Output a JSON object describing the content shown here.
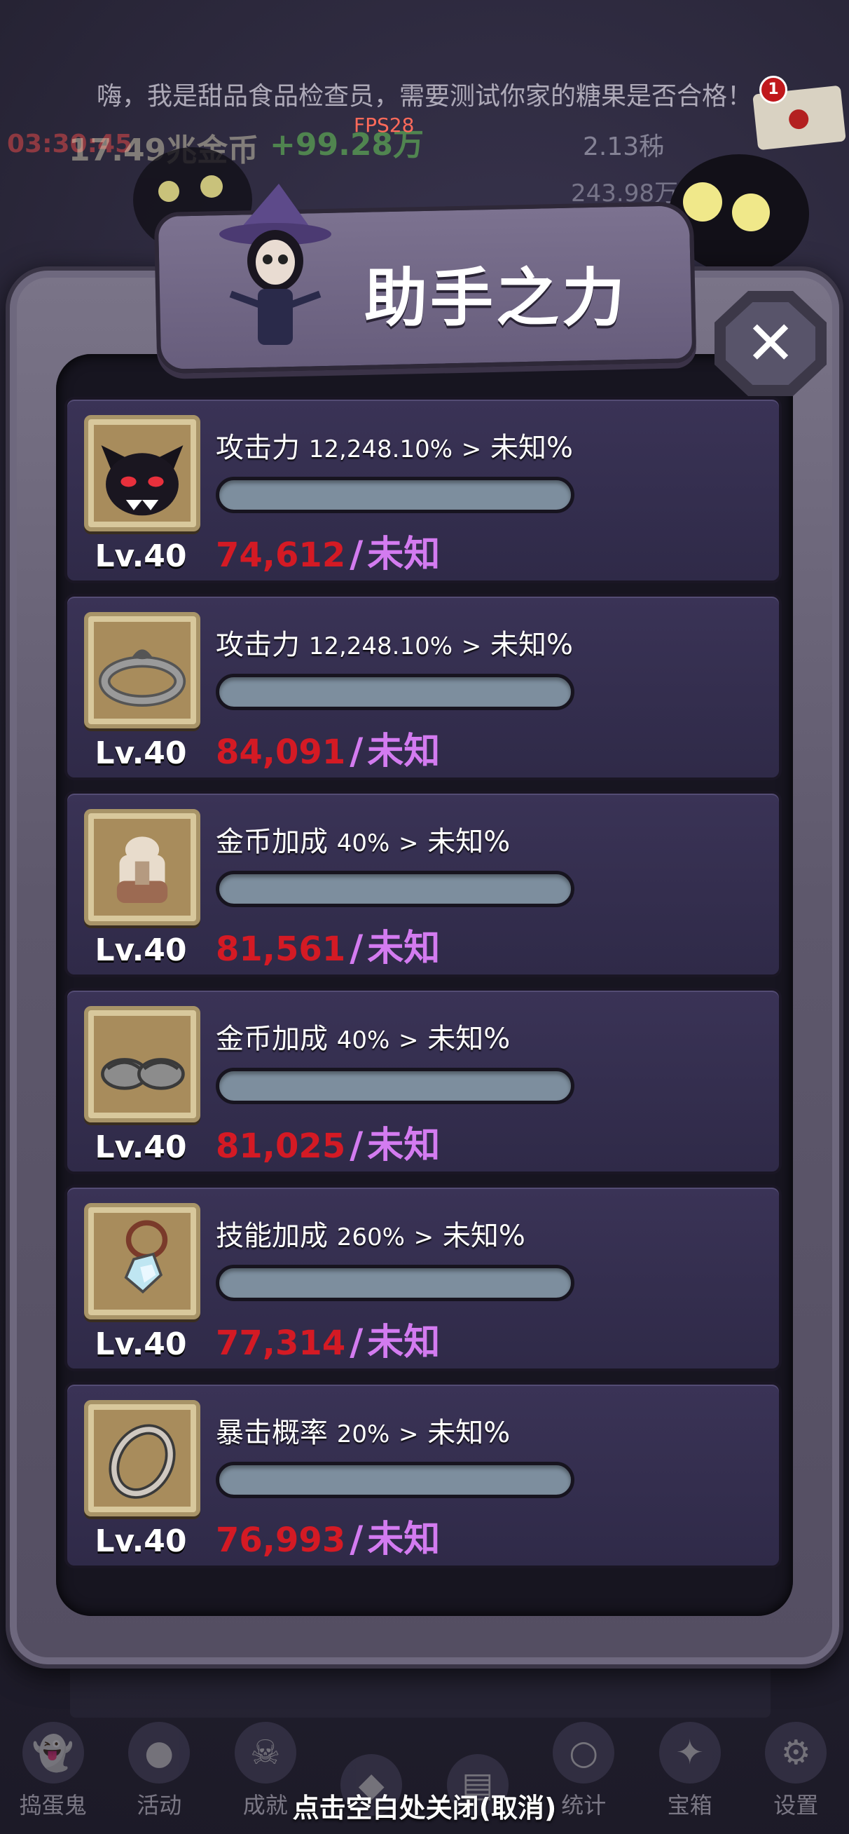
{
  "background": {
    "marquee": "嗨，我是甜品食品检查员，需要测试你家的糖果是否合格！",
    "fps": "FPS28",
    "timer": "03:30:45",
    "gold": "17.49兆金币",
    "gain": "+99.28万",
    "rate": "2.13秭",
    "total": "243.98万",
    "mail_badge": "1",
    "nav": [
      {
        "label": "捣蛋鬼",
        "icon": "ghost-icon"
      },
      {
        "label": "活动",
        "icon": "cauldron-icon"
      },
      {
        "label": "成就",
        "icon": "skull-icon"
      },
      {
        "label": "",
        "icon": "demon-icon"
      },
      {
        "label": "",
        "icon": "book-icon"
      },
      {
        "label": "统计",
        "icon": "orb-icon"
      },
      {
        "label": "宝箱",
        "icon": "gift-icon"
      },
      {
        "label": "设置",
        "icon": "gear-icon"
      }
    ],
    "close_hint": "点击空白处关闭(取消)"
  },
  "dialog": {
    "title": "助手之力",
    "close_icon": "close-icon",
    "items": [
      {
        "icon": "demon-head-icon",
        "level": "Lv.40",
        "stat_name": "攻击力",
        "stat_value": "12,248.10%",
        "arrow": ">",
        "next_value": "未知%",
        "have": "74,612",
        "need": "未知",
        "progress": 0
      },
      {
        "icon": "headband-icon",
        "level": "Lv.40",
        "stat_name": "攻击力",
        "stat_value": "12,248.10%",
        "arrow": ">",
        "next_value": "未知%",
        "have": "84,091",
        "need": "未知",
        "progress": 0
      },
      {
        "icon": "cloak-icon",
        "level": "Lv.40",
        "stat_name": "金币加成",
        "stat_value": "40%",
        "arrow": ">",
        "next_value": "未知%",
        "have": "81,561",
        "need": "未知",
        "progress": 0
      },
      {
        "icon": "slippers-icon",
        "level": "Lv.40",
        "stat_name": "金币加成",
        "stat_value": "40%",
        "arrow": ">",
        "next_value": "未知%",
        "have": "81,025",
        "need": "未知",
        "progress": 0
      },
      {
        "icon": "gem-pendant-icon",
        "level": "Lv.40",
        "stat_name": "技能加成",
        "stat_value": "260%",
        "arrow": ">",
        "next_value": "未知%",
        "have": "77,314",
        "need": "未知",
        "progress": 0
      },
      {
        "icon": "ring-icon",
        "level": "Lv.40",
        "stat_name": "暴击概率",
        "stat_value": "20%",
        "arrow": ">",
        "next_value": "未知%",
        "have": "76,993",
        "need": "未知",
        "progress": 0
      }
    ]
  },
  "colors": {
    "have_red": "#d41a24",
    "need_purple": "#d37bf0",
    "card_bg": "#342e50",
    "bar_track": "#7d8e9e"
  }
}
